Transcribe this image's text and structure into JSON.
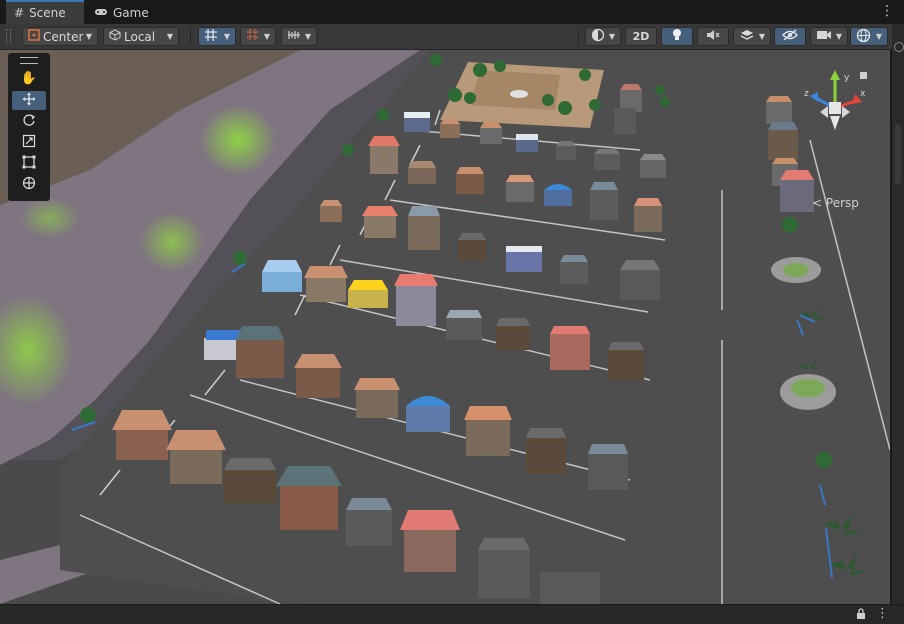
{
  "tabs": [
    {
      "label": "Scene",
      "icon": "grid-icon"
    },
    {
      "label": "Game",
      "icon": "gamepad-icon"
    }
  ],
  "toolbar": {
    "pivot": "Center",
    "handle_rotation": "Local",
    "mode_2d": "2D"
  },
  "scene_view": {
    "camera": "Persp"
  },
  "tools": [
    "hand",
    "move",
    "rotate",
    "scale",
    "rect",
    "transform"
  ],
  "colors": {
    "accent": "#46607c",
    "tab_indicator": "#3a79bb"
  }
}
